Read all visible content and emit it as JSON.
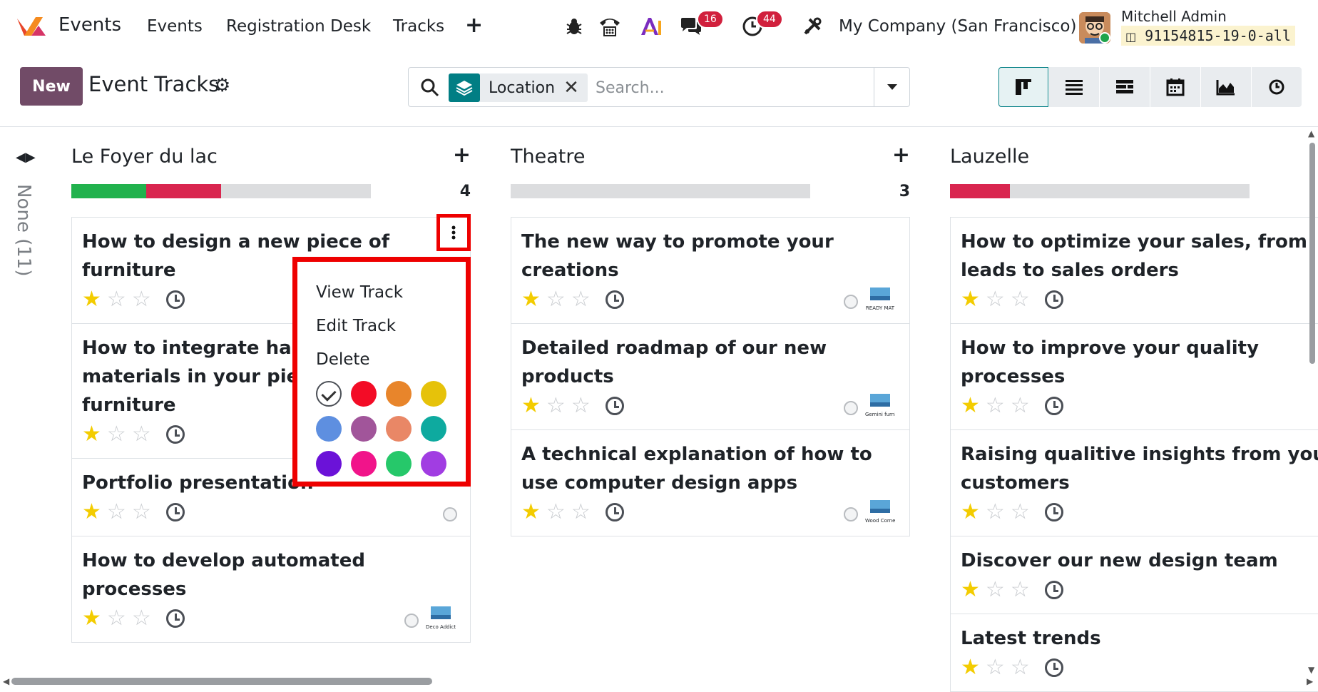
{
  "navbar": {
    "app_name": "Events",
    "menus": [
      "Events",
      "Registration Desk",
      "Tracks"
    ],
    "messages_badge": "16",
    "activities_badge": "44",
    "company": "My Company (San Francisco)",
    "user_name": "Mitchell Admin",
    "db_name": "91154815-19-0-all"
  },
  "control": {
    "new_label": "New",
    "title": "Event Tracks",
    "search": {
      "facet_label": "Location",
      "placeholder": "Search..."
    },
    "views": [
      "kanban-view",
      "list-view",
      "gantt-view",
      "calendar-view",
      "graph-view",
      "activity-view"
    ]
  },
  "folded_column": {
    "label": "None (11)"
  },
  "columns": [
    {
      "title": "Le Foyer du lac",
      "count": "4",
      "progress": [
        {
          "fraction": 0.25,
          "color": "#21b24d"
        },
        {
          "fraction": 0.25,
          "color": "#d9264f"
        }
      ],
      "cards": [
        {
          "title": "How to design a new piece of furniture",
          "stars": 1
        },
        {
          "title": "How to integrate hardware materials in your pieces of furniture",
          "stars": 1
        },
        {
          "title": "Portfolio presentation",
          "stars": 1
        },
        {
          "title": "How to develop automated processes",
          "stars": 1,
          "logo": "Deco Addict"
        }
      ]
    },
    {
      "title": "Theatre",
      "count": "3",
      "progress": [],
      "cards": [
        {
          "title": "The new way to promote your creations",
          "stars": 1,
          "logo": "READY MAT"
        },
        {
          "title": "Detailed roadmap of our new products",
          "stars": 1,
          "logo": "Gemini furniture"
        },
        {
          "title": "A technical explanation of how to use computer design apps",
          "stars": 1,
          "logo": "Wood Corner"
        }
      ]
    },
    {
      "title": "Lauzelle",
      "count": "",
      "progress": [
        {
          "fraction": 0.2,
          "color": "#d9264f"
        }
      ],
      "cards": [
        {
          "title": "How to optimize your sales, from leads to sales orders",
          "stars": 1,
          "state": "red"
        },
        {
          "title": "How to improve your quality processes",
          "stars": 1
        },
        {
          "title": "Raising qualitive insights from your customers",
          "stars": 1
        },
        {
          "title": "Discover our new design team",
          "stars": 1
        },
        {
          "title": "Latest trends",
          "stars": 1
        }
      ]
    }
  ],
  "dropdown": {
    "items": [
      "View Track",
      "Edit Track",
      "Delete"
    ],
    "colors": [
      "#ffffff",
      "#f30c26",
      "#e8852b",
      "#e6c20a",
      "#5e8fe0",
      "#a1559a",
      "#e98766",
      "#0eaa9f",
      "#6b12d8",
      "#f1148a",
      "#26c86a",
      "#a13de2"
    ]
  }
}
